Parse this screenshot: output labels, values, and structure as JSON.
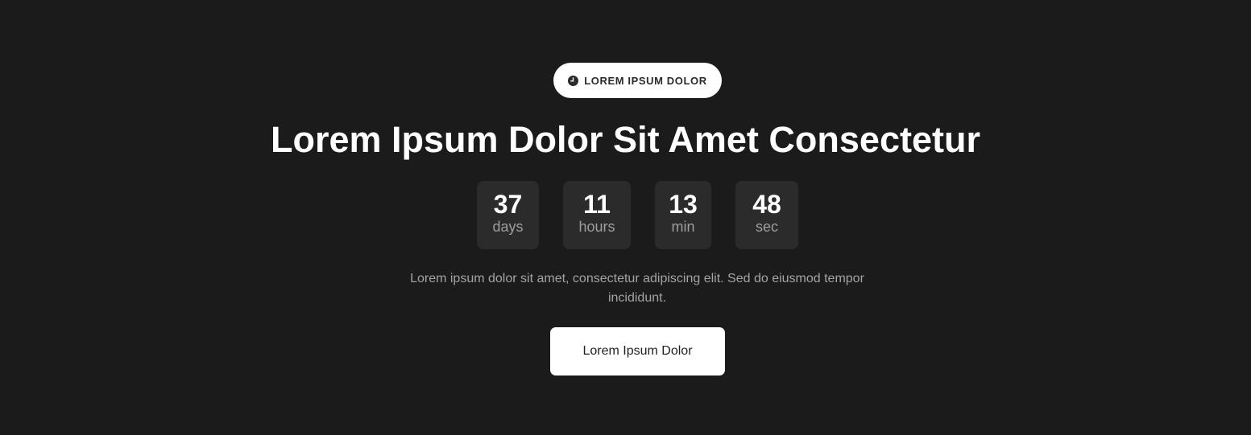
{
  "badge": {
    "icon": "clock-icon",
    "label": "LOREM IPSUM DOLOR"
  },
  "title": "Lorem Ipsum Dolor Sit Amet Consectetur",
  "countdown": [
    {
      "value": "37",
      "unit": "days"
    },
    {
      "value": "11",
      "unit": "hours"
    },
    {
      "value": "13",
      "unit": "min"
    },
    {
      "value": "48",
      "unit": "sec"
    }
  ],
  "description": "Lorem ipsum dolor sit amet, consectetur adipiscing elit. Sed do eiusmod tempor incididunt.",
  "cta": {
    "label": "Lorem Ipsum Dolor"
  },
  "colors": {
    "background": "#1b1b1b",
    "box": "#2b2b2b",
    "text": "#ffffff",
    "muted": "#a3a3a3"
  }
}
